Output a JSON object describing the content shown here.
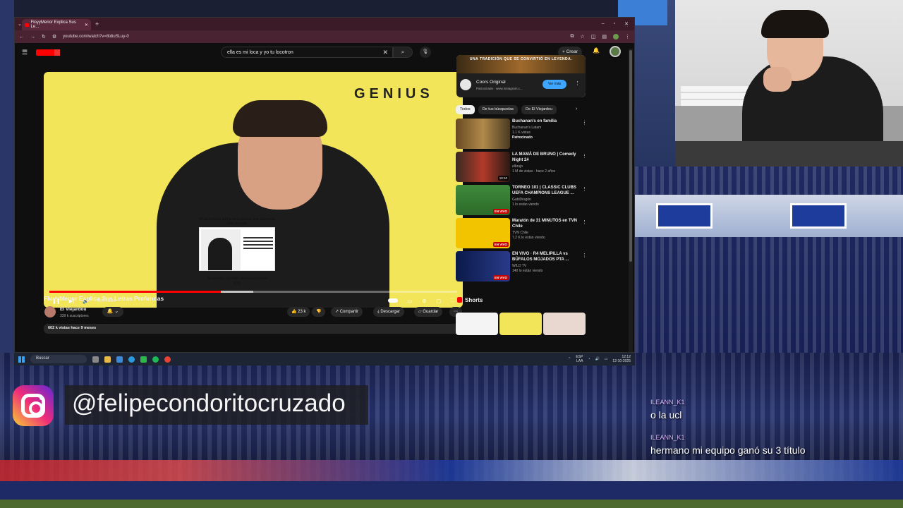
{
  "browser": {
    "tab_title": "FloyyMenor Explica Sus Le...",
    "url": "youtube.com/watch?v=8tdiuSLuy-0"
  },
  "youtube": {
    "search_value": "ella es mi loca y yo tu locotron",
    "create_label": "Crear"
  },
  "player": {
    "brand": "GENIUS",
    "hint_text": "Arrastra hacia arriba para realizar una búsqueda más precisa",
    "moment_text": "Momento con más reproducciones",
    "moment_time": "0:29",
    "time": "0:27 / 1:04",
    "progress_fraction": 0.42
  },
  "video": {
    "title": "FloyyMenor Explica Sus Letras Profundas",
    "channel": "El Viejardou",
    "subs": "339 k suscriptores",
    "likes": "23 k",
    "share": "Compartir",
    "download": "Descargar",
    "save": "Guardar",
    "views_line": "602 k vistas  hace 9 meses"
  },
  "ad": {
    "banner": "UNA TRADICIÓN QUE SE CONVIRTIÓ EN LEYENDA.",
    "name": "Coors Original",
    "sponsor": "Patrocinado · www.instagram.c...",
    "button": "Ver más"
  },
  "chips": [
    "Todos",
    "De tus búsquedas",
    "De El Viejardou"
  ],
  "recommendations": [
    {
      "title": "Buchanan's en familia",
      "channel": "Buchanan's Latam",
      "meta": "1.1 K vistas",
      "extra": "Patrocinado",
      "badge": ""
    },
    {
      "title": "LA MAMÁ DE BRUNO | Comedy Night 2#",
      "channel": "elbrujo",
      "meta": "1 M de vistas · hace 2 años",
      "extra": "",
      "badge": "10:10"
    },
    {
      "title": "TORNEO 101 | CLASSIC CLUBS UEFA CHAMPIONS LEAGUE ...",
      "channel": "GabiDragón",
      "meta": "1 lo están viendo",
      "extra": "",
      "badge": "EN VIVO"
    },
    {
      "title": "Maratón de 31 MINUTOS en TVN Chile",
      "channel": "TVN Chile",
      "meta": "7.2 K lo están viendo",
      "extra": "",
      "badge": "EN VIVO"
    },
    {
      "title": "EN VIVO · R4 MELIPILLA vs BÚFALOS MOJADOS PTA ...",
      "channel": "WILD TV",
      "meta": "140 lo están viendo",
      "extra": "",
      "badge": "EN VIVO"
    }
  ],
  "shorts_label": "Shorts",
  "taskbar": {
    "search": "Buscar",
    "lang": "ESP",
    "lang2": "LAA",
    "time": "12:12",
    "date": "12-10-2025"
  },
  "overlay": {
    "handle": "@felipecondoritocruzado",
    "chat": [
      {
        "user": "ILEANN_K1",
        "text": "o la ucl"
      },
      {
        "user": "ILEANN_K1",
        "text": "hermano mi equipo ganó su 3 título"
      }
    ]
  },
  "colors": {
    "accent": "#ff0000",
    "chip_active": "#f1f1f1",
    "ad_button": "#3ea6ff",
    "live": "#cc0000"
  }
}
